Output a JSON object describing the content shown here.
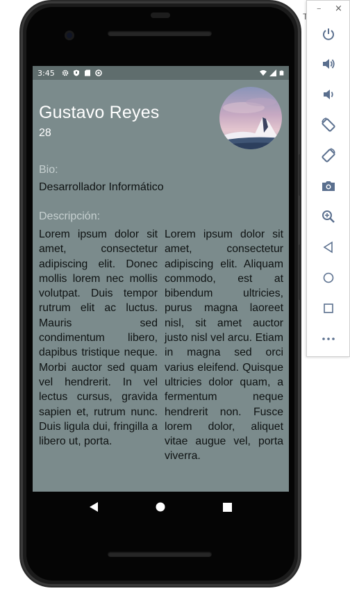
{
  "status_bar": {
    "time": "3:45"
  },
  "profile": {
    "name": "Gustavo Reyes",
    "age": "28",
    "bio_label": "Bio:",
    "bio_value": "Desarrollador Informático",
    "description_label": "Descripción:",
    "description_col1": "Lorem ipsum dolor sit amet, consectetur adipiscing elit. Donec mollis lorem nec mollis volutpat. Duis tempor rutrum elit ac luctus. Mauris sed condimentum libero, dapibus tristique neque. Morbi auctor sed quam vel hendrerit. In vel lectus cursus, gravida sapien et, rutrum nunc. Duis ligula dui, fringilla a libero ut, porta.",
    "description_col2": "Lorem ipsum dolor sit amet, consectetur adipiscing elit. Aliquam commodo, est at bibendum ultricies, purus magna laoreet nisl, sit amet auctor justo nisl vel arcu. Etiam in magna sed orci varius eleifend. Quisque ultricies dolor quam, a fermentum neque hendrerit non. Fusce lorem dolor, aliquet vitae augue vel, porta viverra."
  },
  "emulator_panel": {
    "minimize_glyph": "–",
    "close_glyph": "×",
    "buttons": [
      "power-icon",
      "volume-up-icon",
      "volume-down-icon",
      "rotate-left-icon",
      "rotate-right-icon",
      "camera-icon",
      "zoom-icon",
      "back-icon",
      "home-icon",
      "overview-icon",
      "more-icon"
    ]
  },
  "colors": {
    "screen_bg": "#7b8b8c",
    "status_bar_bg": "#5f6d6d",
    "label_color": "#c6d0d0",
    "emulator_icon": "#5a6f8e"
  }
}
